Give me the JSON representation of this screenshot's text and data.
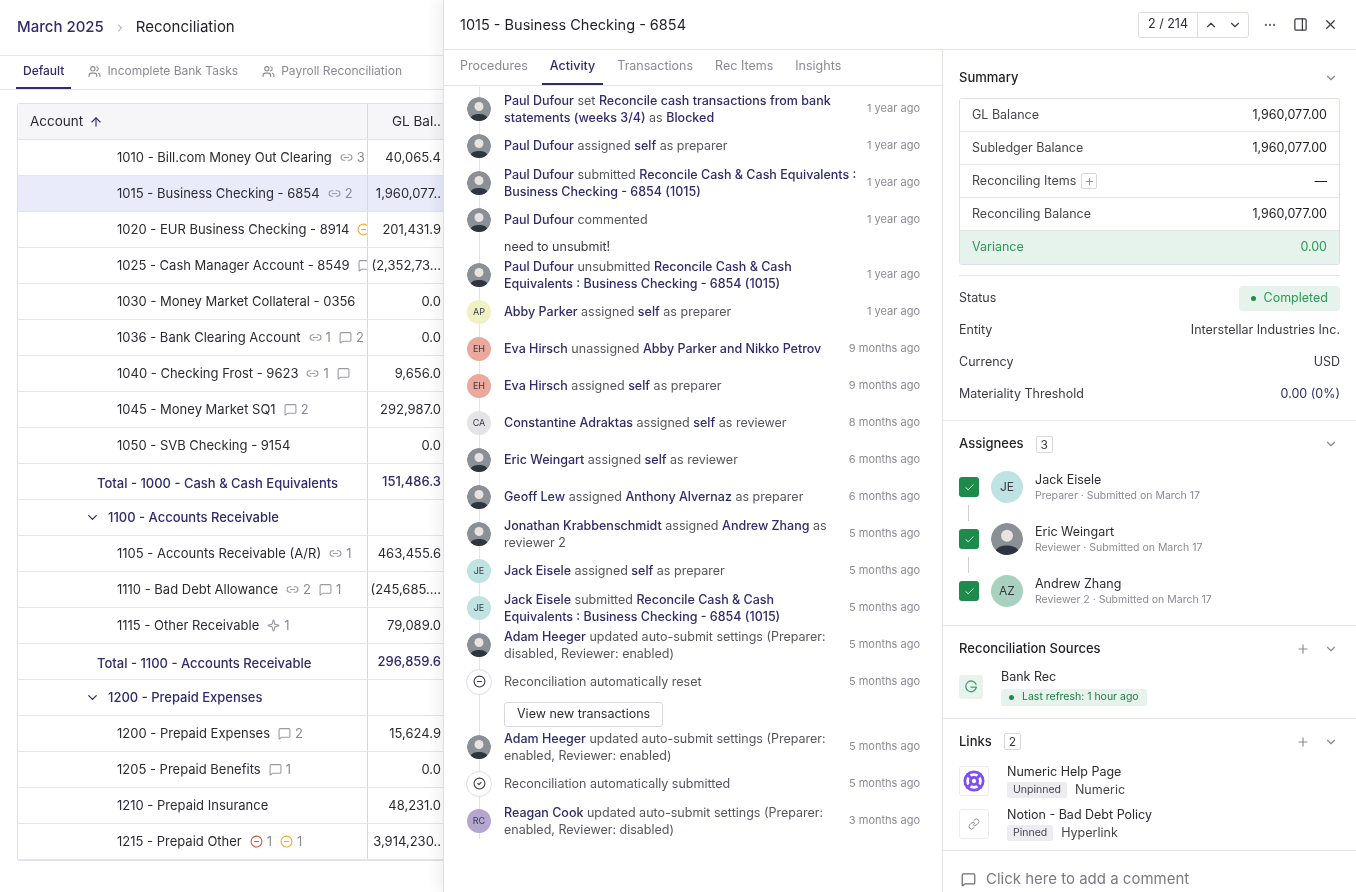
{
  "breadcrumb": {
    "period": "March 2025",
    "page": "Reconciliation"
  },
  "views": [
    {
      "label": "Default",
      "selected": true,
      "shared": false
    },
    {
      "label": "Incomplete Bank Tasks",
      "selected": false,
      "shared": true
    },
    {
      "label": "Payroll Reconciliation",
      "selected": false,
      "shared": true
    }
  ],
  "table": {
    "columns": [
      "Account",
      "GL Bal.."
    ],
    "rows": [
      {
        "kind": "account",
        "selected": false,
        "name": "1010 - Bill.com Money Out Clearing",
        "badges": [
          {
            "kind": "link",
            "count": "3"
          }
        ],
        "balance": "40,065.4"
      },
      {
        "kind": "account",
        "selected": true,
        "name": "1015 - Business Checking - 6854",
        "badges": [
          {
            "kind": "link",
            "count": "2"
          }
        ],
        "balance": "1,960,077.."
      },
      {
        "kind": "account",
        "selected": false,
        "name": "1020 - EUR Business Checking - 8914",
        "badges": [
          {
            "kind": "pending"
          }
        ],
        "balance": "201,431.9"
      },
      {
        "kind": "account",
        "selected": false,
        "name": "1025 - Cash Manager Account - 8549",
        "badges": [
          {
            "kind": "comment"
          }
        ],
        "balance": "(2,352,73..."
      },
      {
        "kind": "account",
        "selected": false,
        "name": "1030 - Money Market Collateral - 0356",
        "badges": [],
        "balance": "0.0"
      },
      {
        "kind": "account",
        "selected": false,
        "name": "1036 - Bank Clearing Account",
        "badges": [
          {
            "kind": "link",
            "count": "1"
          },
          {
            "kind": "comment",
            "count": "2"
          }
        ],
        "balance": "0.0"
      },
      {
        "kind": "account",
        "selected": false,
        "name": "1040 - Checking Frost - 9623",
        "badges": [
          {
            "kind": "link",
            "count": "1"
          },
          {
            "kind": "comment"
          }
        ],
        "balance": "9,656.0"
      },
      {
        "kind": "account",
        "selected": false,
        "name": "1045 - Money Market SQ1",
        "badges": [
          {
            "kind": "comment",
            "count": "2"
          }
        ],
        "balance": "292,987.0"
      },
      {
        "kind": "account",
        "selected": false,
        "name": "1050 - SVB Checking - 9154",
        "badges": [],
        "balance": "0.0"
      },
      {
        "kind": "total",
        "selected": false,
        "name": "Total - 1000 - Cash & Cash Equivalents",
        "balance": "151,486.3"
      },
      {
        "kind": "group",
        "selected": false,
        "name": "1100 - Accounts Receivable"
      },
      {
        "kind": "account",
        "selected": false,
        "name": "1105 - Accounts Receivable (A/R)",
        "badges": [
          {
            "kind": "link",
            "count": "1"
          }
        ],
        "balance": "463,455.6"
      },
      {
        "kind": "account",
        "selected": false,
        "name": "1110 - Bad Debt Allowance",
        "badges": [
          {
            "kind": "link",
            "count": "2"
          },
          {
            "kind": "comment",
            "count": "1"
          }
        ],
        "balance": "(245,685...."
      },
      {
        "kind": "account",
        "selected": false,
        "name": "1115 - Other Receivable",
        "badges": [
          {
            "kind": "sparkle",
            "count": "1"
          }
        ],
        "balance": "79,089.0"
      },
      {
        "kind": "total",
        "selected": false,
        "name": "Total - 1100 - Accounts Receivable",
        "balance": "296,859.6"
      },
      {
        "kind": "group",
        "selected": false,
        "name": "1200 - Prepaid Expenses"
      },
      {
        "kind": "account",
        "selected": false,
        "name": "1200 - Prepaid Expenses",
        "badges": [
          {
            "kind": "comment",
            "count": "2"
          }
        ],
        "balance": "15,624.9"
      },
      {
        "kind": "account",
        "selected": false,
        "name": "1205 - Prepaid Benefits",
        "badges": [
          {
            "kind": "comment",
            "count": "1"
          }
        ],
        "balance": "0.0"
      },
      {
        "kind": "account",
        "selected": false,
        "name": "1210 - Prepaid Insurance",
        "badges": [],
        "balance": "48,231.0"
      },
      {
        "kind": "account",
        "selected": false,
        "name": "1215 - Prepaid Other",
        "badges": [
          {
            "kind": "error",
            "count": "1"
          },
          {
            "kind": "pending",
            "count": "1"
          }
        ],
        "balance": "3,914,230.."
      }
    ]
  },
  "drawer": {
    "title": "1015 - Business Checking - 6854",
    "pager": "2 / 214",
    "tabs": [
      {
        "label": "Procedures",
        "selected": false
      },
      {
        "label": "Activity",
        "selected": true
      },
      {
        "label": "Transactions",
        "selected": false
      },
      {
        "label": "Rec Items",
        "selected": false
      },
      {
        "label": "Insights",
        "selected": false
      }
    ],
    "activity": [
      {
        "avatar": {
          "kind": "photo"
        },
        "text": "**Paul Dufour** set **Reconcile cash transactions from bank statements (weeks 3/4)** as **Blocked**",
        "time": "1 year ago"
      },
      {
        "avatar": {
          "kind": "photo"
        },
        "text": "**Paul Dufour** assigned **self** as preparer",
        "time": "1 year ago"
      },
      {
        "avatar": {
          "kind": "photo"
        },
        "text": "**Paul Dufour** submitted **Reconcile Cash & Cash Equivalents : Business Checking - 6854 (1015)**",
        "time": "1 year ago"
      },
      {
        "avatar": {
          "kind": "photo"
        },
        "text": "**Paul Dufour** commented",
        "time": "1 year ago",
        "comment": "need to unsubmit!"
      },
      {
        "avatar": {
          "kind": "photo"
        },
        "text": "**Paul Dufour** unsubmitted **Reconcile Cash & Cash Equivalents : Business Checking - 6854 (1015)**",
        "time": "1 year ago"
      },
      {
        "avatar": {
          "kind": "initials",
          "initials": "AP",
          "color": "#f1f0c4"
        },
        "text": "**Abby Parker** assigned **self** as preparer",
        "time": "1 year ago"
      },
      {
        "avatar": {
          "kind": "initials",
          "initials": "EH",
          "color": "#eba89c"
        },
        "text": "**Eva Hirsch** unassigned **Abby Parker and Nikko Petrov**",
        "time": "9 months ago"
      },
      {
        "avatar": {
          "kind": "initials",
          "initials": "EH",
          "color": "#eba89c"
        },
        "text": "**Eva Hirsch** assigned **self** as preparer",
        "time": "9 months ago"
      },
      {
        "avatar": {
          "kind": "initials",
          "initials": "CA",
          "color": "#e4e4e6"
        },
        "text": "**Constantine Adraktas** assigned **self** as reviewer",
        "time": "8 months ago"
      },
      {
        "avatar": {
          "kind": "photo"
        },
        "text": "**Eric Weingart** assigned **self** as reviewer",
        "time": "6 months ago"
      },
      {
        "avatar": {
          "kind": "photo"
        },
        "text": "**Geoff Lew** assigned **Anthony Alvernaz** as preparer",
        "time": "6 months ago"
      },
      {
        "avatar": {
          "kind": "photo"
        },
        "text": "**Jonathan Krabbenschmidt** assigned **Andrew Zhang** as reviewer 2",
        "time": "5 months ago"
      },
      {
        "avatar": {
          "kind": "initials",
          "initials": "JE",
          "color": "#bfe2e2"
        },
        "text": "**Jack Eisele** assigned **self** as preparer",
        "time": "5 months ago"
      },
      {
        "avatar": {
          "kind": "initials",
          "initials": "JE",
          "color": "#bfe2e2"
        },
        "text": "**Jack Eisele** submitted **Reconcile Cash & Cash Equivalents : Business Checking - 6854 (1015)**",
        "time": "5 months ago"
      },
      {
        "avatar": {
          "kind": "photo"
        },
        "text": "**Adam Heeger** updated auto-submit settings (Preparer: disabled, Reviewer: enabled)",
        "time": "5 months ago"
      },
      {
        "avatar": {
          "kind": "reset"
        },
        "text": "Reconciliation automatically reset",
        "time": "5 months ago",
        "button": "View new transactions"
      },
      {
        "avatar": {
          "kind": "photo"
        },
        "text": "**Adam Heeger** updated auto-submit settings (Preparer: enabled, Reviewer: enabled)",
        "time": "5 months ago"
      },
      {
        "avatar": {
          "kind": "submitted"
        },
        "text": "Reconciliation automatically submitted",
        "time": "5 months ago"
      },
      {
        "avatar": {
          "kind": "initials",
          "initials": "RC",
          "color": "#b3a6cf"
        },
        "text": "**Reagan Cook** updated auto-submit settings (Preparer: enabled, Reviewer: disabled)",
        "time": "3 months ago"
      }
    ]
  },
  "summary": {
    "title": "Summary",
    "rows": [
      {
        "kind": "plain",
        "label": "GL Balance",
        "value": "1,960,077.00"
      },
      {
        "kind": "plain",
        "label": "Subledger Balance",
        "value": "1,960,077.00"
      },
      {
        "kind": "add",
        "label": "Reconciling Items",
        "value": "—"
      },
      {
        "kind": "plain",
        "label": "Reconciling Balance",
        "value": "1,960,077.00"
      },
      {
        "kind": "variance",
        "label": "Variance",
        "value": "0.00"
      }
    ],
    "details": [
      {
        "kind": "status",
        "label": "Status",
        "value": "Completed"
      },
      {
        "kind": "plain",
        "label": "Entity",
        "value": "Interstellar Industries Inc."
      },
      {
        "kind": "plain",
        "label": "Currency",
        "value": "USD"
      },
      {
        "kind": "link",
        "label": "Materiality Threshold",
        "value": "0.00 (0%)"
      }
    ]
  },
  "assignees": {
    "title": "Assignees",
    "count": "3",
    "items": [
      {
        "checked": true,
        "avatar": {
          "kind": "initials",
          "initials": "JE",
          "color": "#bfe2e2"
        },
        "name": "Jack Eisele",
        "role": "Preparer · Submitted on March 17"
      },
      {
        "checked": true,
        "avatar": {
          "kind": "photo"
        },
        "name": "Eric Weingart",
        "role": "Reviewer · Submitted on March 17"
      },
      {
        "checked": true,
        "avatar": {
          "kind": "initials",
          "initials": "AZ",
          "color": "#a9d1bf"
        },
        "name": "Andrew Zhang",
        "role": "Reviewer 2 · Submitted on March 17"
      }
    ]
  },
  "sources": {
    "title": "Reconciliation Sources",
    "items": [
      {
        "name": "Bank Rec",
        "refresh": "Last refresh: 1 hour ago"
      }
    ]
  },
  "links": {
    "title": "Links",
    "count": "2",
    "items": [
      {
        "kind": "help",
        "title": "Numeric Help Page",
        "tag": "Unpinned",
        "source": "Numeric"
      },
      {
        "kind": "link",
        "title": "Notion - Bad Debt Policy",
        "tag": "Pinned",
        "source": "Hyperlink"
      }
    ]
  },
  "comment": {
    "placeholder": "Click here to add a comment"
  }
}
